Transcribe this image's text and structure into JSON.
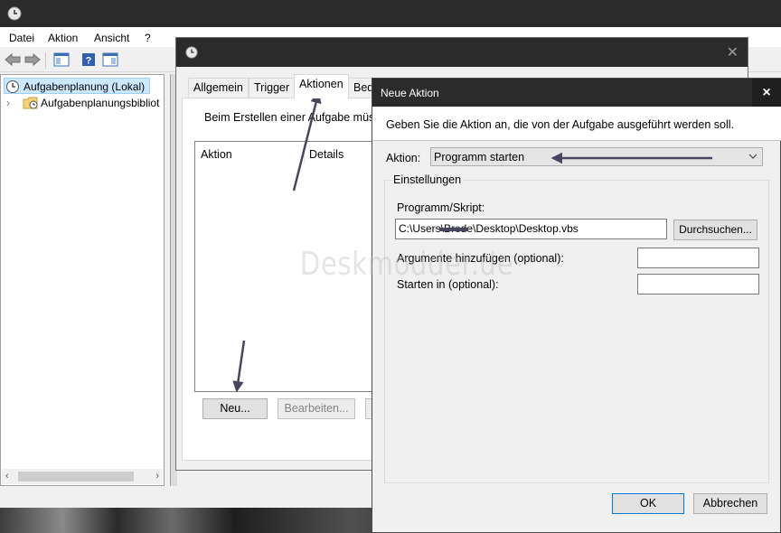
{
  "mmc": {
    "menu": [
      "Datei",
      "Aktion",
      "Ansicht",
      "?"
    ],
    "tree": {
      "root": "Aufgabenplanung (Lokal)",
      "child": "Aufgabenplanungsbibliot"
    }
  },
  "task_window": {
    "tabs": [
      "Allgemein",
      "Trigger",
      "Aktionen",
      "Bed"
    ],
    "active_tab": "Aktionen",
    "intro_text": "Beim Erstellen einer Aufgabe müs",
    "columns": [
      "Aktion",
      "Details"
    ],
    "buttons": {
      "new": "Neu...",
      "edit": "Bearbeiten..."
    }
  },
  "dialog": {
    "title": "Neue Aktion",
    "close": "×",
    "description": "Geben Sie die Aktion an, die von der Aufgabe ausgeführt werden soll.",
    "action_label": "Aktion:",
    "action_value": "Programm starten",
    "group_label": "Einstellungen",
    "program_label": "Programm/Skript:",
    "program_value": "C:\\Users\\Brede\\Desktop\\Desktop.vbs",
    "browse": "Durchsuchen...",
    "args_label": "Argumente hinzufügen (optional):",
    "args_value": "",
    "start_label": "Starten in (optional):",
    "start_value": "",
    "ok": "OK",
    "cancel": "Abbrechen"
  },
  "watermark": "Deskmodder.de",
  "colors": {
    "titlebar_dark": "#2b2b2b",
    "window_bg": "#f0f0f0",
    "arrow": "#464660",
    "selection": "#cce8ff"
  }
}
